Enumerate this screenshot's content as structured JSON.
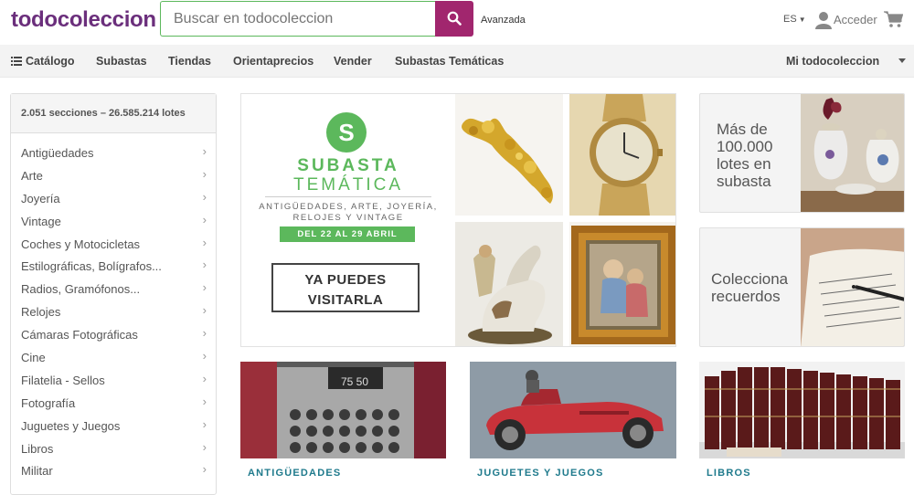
{
  "header": {
    "logo": "todocoleccion",
    "search_placeholder": "Buscar en todocoleccion",
    "advanced": "Avanzada",
    "lang": "ES",
    "login": "Acceder"
  },
  "nav": {
    "items": [
      "Catálogo",
      "Subastas",
      "Tiendas",
      "Orientaprecios",
      "Vender",
      "Subastas Temáticas"
    ],
    "account": "Mi todocoleccion"
  },
  "sidebar": {
    "header": "2.051 secciones – 26.585.214 lotes",
    "items": [
      "Antigüedades",
      "Arte",
      "Joyería",
      "Vintage",
      "Coches y Motocicletas",
      "Estilográficas, Bolígrafos...",
      "Radios, Gramófonos...",
      "Relojes",
      "Cámaras Fotográficas",
      "Cine",
      "Filatelia - Sellos",
      "Fotografía",
      "Juguetes y Juegos",
      "Libros",
      "Militar"
    ]
  },
  "banner": {
    "letter": "S",
    "title_1": "SUBASTA",
    "title_2": "TEMÁTICA",
    "subtitle": "ANTIGÜEDADES, ARTE, JOYERÍA, RELOJES Y VINTAGE",
    "dates": "DEL 22 AL 29 ABRIL",
    "cta_line1": "YA PUEDES",
    "cta_line2": "VISITARLA"
  },
  "promos": [
    {
      "lines": [
        "Más de",
        "100.000",
        "lotes en",
        "subasta"
      ]
    },
    {
      "lines": [
        "Colecciona",
        "recuerdos"
      ]
    }
  ],
  "tiles": [
    {
      "caption": "ANTIGÜEDADES"
    },
    {
      "caption": "JUGUETES Y JUEGOS"
    },
    {
      "caption": "LIBROS"
    }
  ],
  "colors": {
    "brand": "#6b2f7c",
    "search_button": "#a1266e",
    "green": "#5cb85c",
    "caption": "#1f7a8c"
  }
}
